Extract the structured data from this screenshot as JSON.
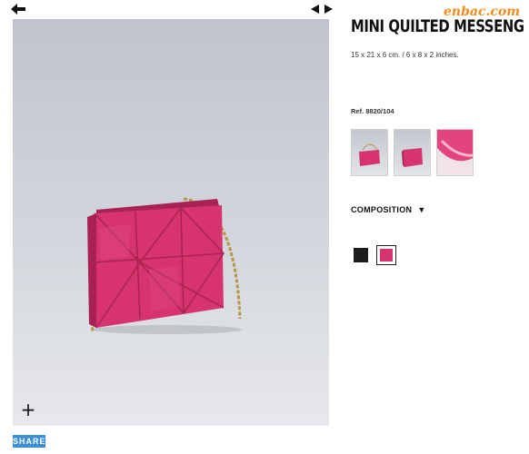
{
  "product": {
    "title": "MINI QUILTED MESSENG",
    "dimensions": "15 x 21 x 6 cm. / 6 x 8 x 2 inches.",
    "reference": "Ref. 8820/104",
    "composition_label": "COMPOSITION"
  },
  "watermark": "enbac.com",
  "actions": {
    "share_label": "SHARE",
    "zoom_symbol": "+"
  },
  "colors": {
    "accent_blue": "#3a8fd8",
    "bag_pink": "#d6336f",
    "swatch_black": "#1c1c1c"
  },
  "swatches": [
    {
      "name": "black",
      "color": "#1c1c1c",
      "selected": false
    },
    {
      "name": "pink",
      "color": "#d6336f",
      "selected": true
    }
  ],
  "icons": {
    "back": "arrow-left-icon",
    "prev": "triangle-left-icon",
    "next": "triangle-right-icon",
    "composition": "triangle-down-icon",
    "zoom": "plus-icon"
  }
}
